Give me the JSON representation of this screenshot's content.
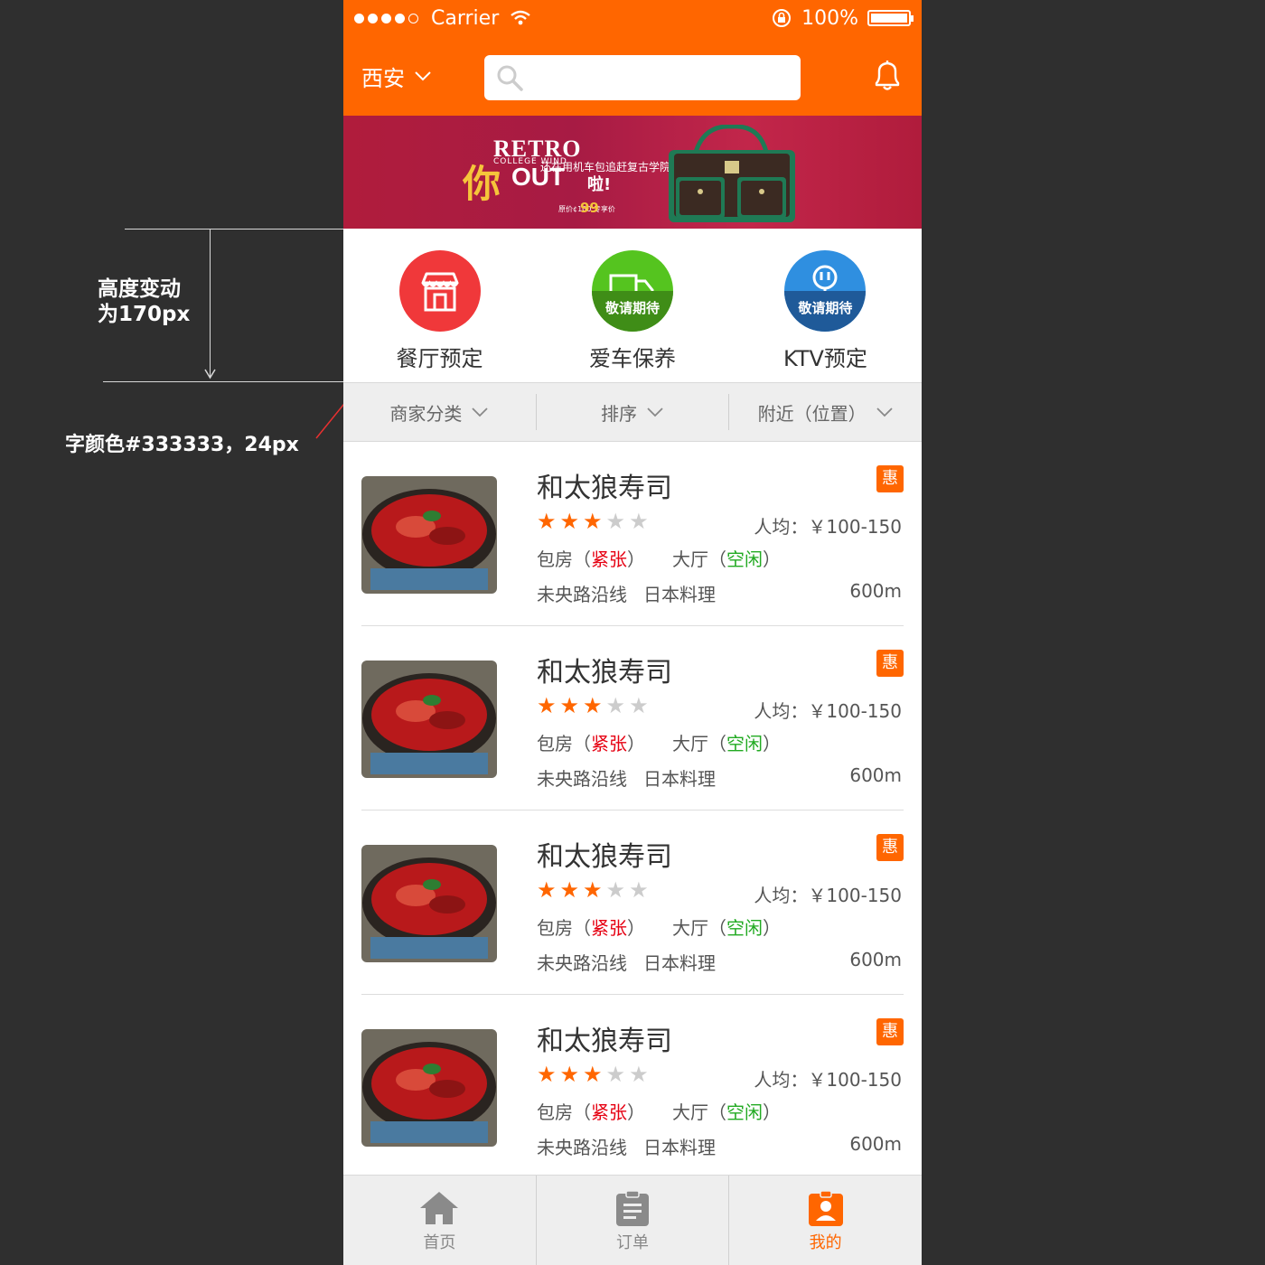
{
  "annotations": {
    "height_line1": "高度变动",
    "height_line2": "为170px",
    "font_note": "字颜色#333333，24px"
  },
  "status": {
    "carrier": "Carrier",
    "battery": "100%",
    "signal_dots": 5,
    "signal_filled": 4
  },
  "nav": {
    "city": "西安",
    "search_placeholder": ""
  },
  "banner": {
    "title": "RETRO",
    "subtitle": "COLLEGE WIND",
    "big": "你",
    "out": "OUT",
    "line": "还在用机车包追赶复古学院风?",
    "la": "啦!",
    "price_label": "原价¢100 专享价",
    "price": "99"
  },
  "categories": [
    {
      "label": "餐厅预定",
      "color": "#f0383a",
      "icon": "storefront-icon",
      "overlay": ""
    },
    {
      "label": "爱车保养",
      "color": "#55c41f",
      "icon": "truck-icon",
      "overlay": "敬请期待"
    },
    {
      "label": "KTV预定",
      "color": "#2f8fe0",
      "icon": "microphone-icon",
      "overlay": "敬请期待"
    }
  ],
  "filters": [
    {
      "label": "商家分类"
    },
    {
      "label": "排序"
    },
    {
      "label": "附近（位置）"
    }
  ],
  "restaurants": [
    {
      "name": "和太狼寿司",
      "badge": "惠",
      "rating": 3,
      "price": "人均：￥100-150",
      "room_label": "包房（",
      "room_status": "紧张",
      "hall_label": "大厅（",
      "hall_status": "空闲",
      "close": "）",
      "tag1": "未央路沿线",
      "tag2": "日本料理",
      "distance": "600m"
    },
    {
      "name": "和太狼寿司",
      "badge": "惠",
      "rating": 3,
      "price": "人均：￥100-150",
      "room_label": "包房（",
      "room_status": "紧张",
      "hall_label": "大厅（",
      "hall_status": "空闲",
      "close": "）",
      "tag1": "未央路沿线",
      "tag2": "日本料理",
      "distance": "600m"
    },
    {
      "name": "和太狼寿司",
      "badge": "惠",
      "rating": 3,
      "price": "人均：￥100-150",
      "room_label": "包房（",
      "room_status": "紧张",
      "hall_label": "大厅（",
      "hall_status": "空闲",
      "close": "）",
      "tag1": "未央路沿线",
      "tag2": "日本料理",
      "distance": "600m"
    },
    {
      "name": "和太狼寿司",
      "badge": "惠",
      "rating": 3,
      "price": "人均：￥100-150",
      "room_label": "包房（",
      "room_status": "紧张",
      "hall_label": "大厅（",
      "hall_status": "空闲",
      "close": "）",
      "tag1": "未央路沿线",
      "tag2": "日本料理",
      "distance": "600m"
    }
  ],
  "tabs": [
    {
      "label": "首页",
      "icon": "home-icon",
      "active": false
    },
    {
      "label": "订单",
      "icon": "clipboard-icon",
      "active": false
    },
    {
      "label": "我的",
      "icon": "profile-badge-icon",
      "active": true
    }
  ],
  "colors": {
    "brand": "#ff6600",
    "text": "#333333",
    "busy": "#e60012",
    "free": "#22aa22"
  }
}
